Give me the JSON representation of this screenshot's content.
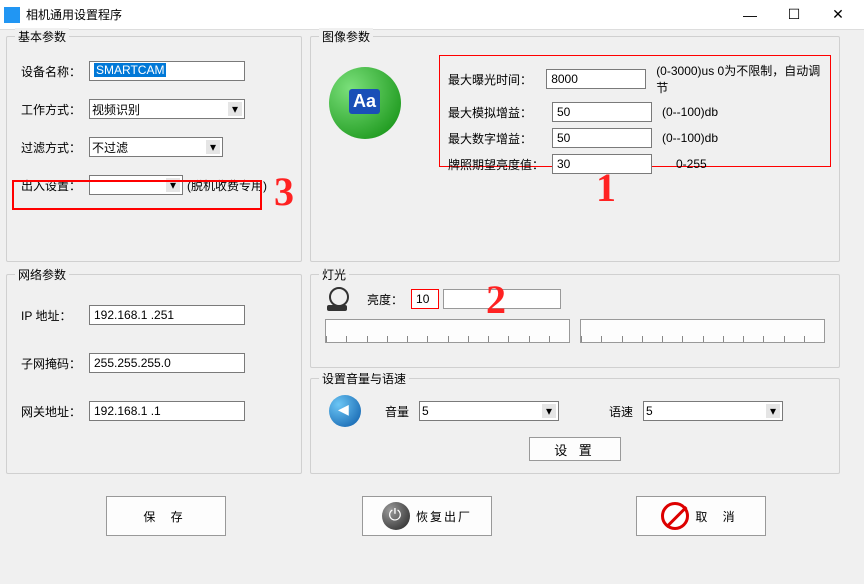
{
  "window": {
    "title": "相机通用设置程序",
    "min": "—",
    "max": "☐",
    "close": "✕"
  },
  "basic": {
    "legend": "基本参数",
    "deviceNameLabel": "设备名称：",
    "deviceNameValue": "SMARTCAM",
    "workModeLabel": "工作方式：",
    "workModeValue": "视频识别",
    "filterLabel": "过滤方式：",
    "filterValue": "不过滤",
    "ioLabel": "出入设置：",
    "ioValue": "",
    "ioNote": "(脱机收费专用)"
  },
  "net": {
    "legend": "网络参数",
    "ipLabel": "IP 地址：",
    "ipValue": "192.168.1 .251",
    "maskLabel": "子网掩码：",
    "maskValue": "255.255.255.0",
    "gwLabel": "网关地址：",
    "gwValue": "192.168.1 .1"
  },
  "image": {
    "legend": "图像参数",
    "maxExpLabel": "最大曝光时间：",
    "maxExpValue": "8000",
    "maxExpNote": "(0-3000)us 0为不限制，自动调节",
    "maxAGainLabel": "最大模拟增益：",
    "maxAGainValue": "50",
    "maxAGainNote": "(0--100)db",
    "maxDGainLabel": "最大数字增益：",
    "maxDGainValue": "50",
    "maxDGainNote": "(0--100)db",
    "brightLabel": "牌照期望亮度值：",
    "brightValue": "30",
    "brightNote": "0-255"
  },
  "light": {
    "legend": "灯光",
    "brightnessLabel": "亮度：",
    "brightnessValue": "10"
  },
  "audio": {
    "legend": "设置音量与语速",
    "volLabel": "音量",
    "volValue": "5",
    "speedLabel": "语速",
    "speedValue": "5",
    "setBtn": "设  置"
  },
  "buttons": {
    "save": "保  存",
    "restore": "恢复出厂",
    "cancel": "取  消"
  },
  "annotations": {
    "n1": "1",
    "n2": "2",
    "n3": "3"
  }
}
